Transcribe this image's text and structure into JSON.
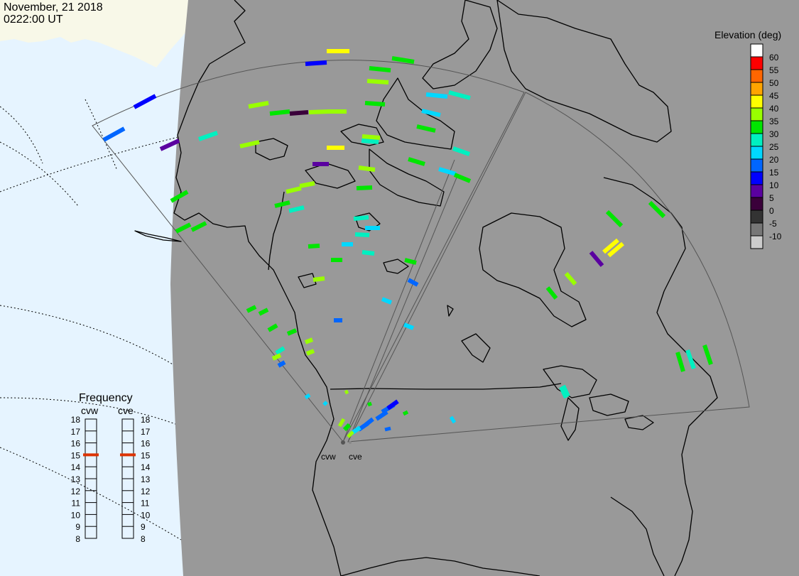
{
  "header": {
    "date": "November, 21 2018",
    "time": "0222:00 UT"
  },
  "colorbar": {
    "title": "Elevation (deg)",
    "entries": [
      {
        "label": "60",
        "color": "#ffffff"
      },
      {
        "label": "55",
        "color": "#ff0000"
      },
      {
        "label": "50",
        "color": "#ff6600"
      },
      {
        "label": "45",
        "color": "#ffa500"
      },
      {
        "label": "40",
        "color": "#ffff00"
      },
      {
        "label": "35",
        "color": "#99ff00"
      },
      {
        "label": "30",
        "color": "#00e600"
      },
      {
        "label": "25",
        "color": "#00f0c0"
      },
      {
        "label": "20",
        "color": "#00d8ff"
      },
      {
        "label": "15",
        "color": "#0066ff"
      },
      {
        "label": "10",
        "color": "#0000ff"
      },
      {
        "label": "5",
        "color": "#5a00a0"
      },
      {
        "label": "0",
        "color": "#3a003a"
      },
      {
        "label": "-5",
        "color": "#333333"
      },
      {
        "label": "-10",
        "color": "#777777"
      },
      {
        "label": "",
        "color": "#cccccc"
      }
    ]
  },
  "frequency": {
    "title": "Frequency",
    "scale": [
      "18",
      "17",
      "16",
      "15",
      "14",
      "13",
      "12",
      "11",
      "10",
      "9",
      "8"
    ],
    "radars": [
      {
        "name": "cvw",
        "value": 15
      },
      {
        "name": "cve",
        "value": 15
      }
    ],
    "marker_color": "#dd3300"
  },
  "radar_sites": [
    "cvw",
    "cve"
  ],
  "colors": {
    "ocean": "#e6f4ff",
    "land": "#f8f8e8",
    "night": "#999999",
    "coast": "#000000"
  }
}
